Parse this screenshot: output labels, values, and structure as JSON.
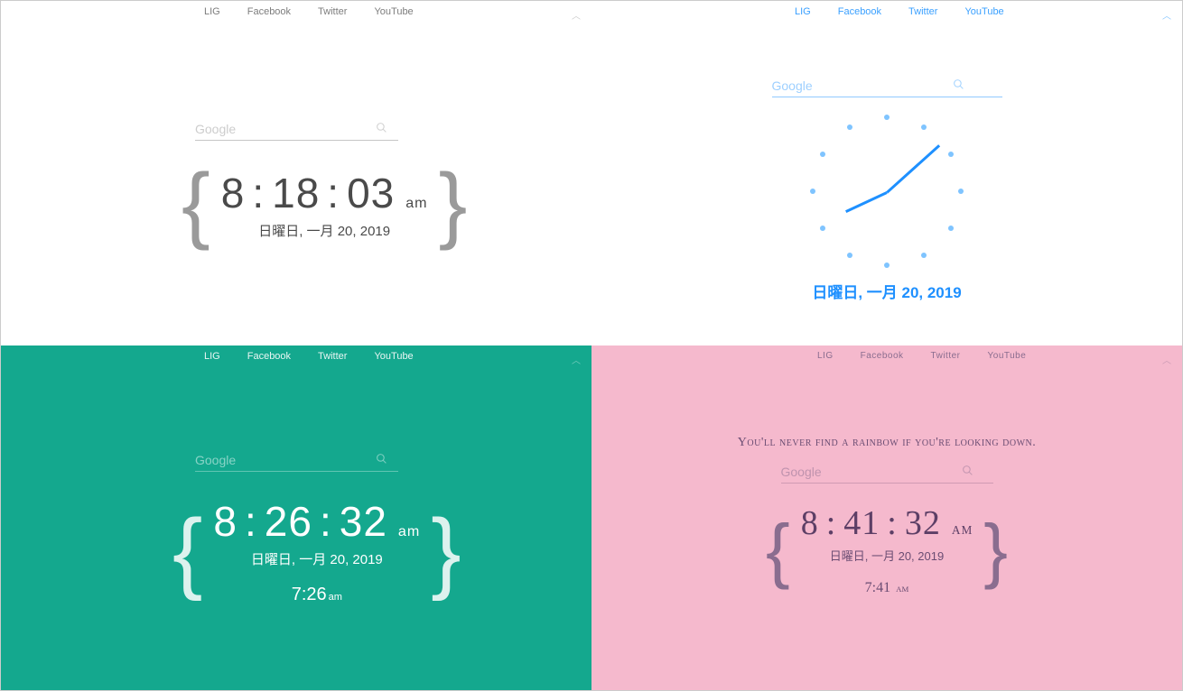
{
  "nav_links": [
    "LIG",
    "Facebook",
    "Twitter",
    "YouTube"
  ],
  "search_placeholder": "Google",
  "panels": {
    "p1": {
      "hour": "8",
      "min": "18",
      "sec": "03",
      "ampm": "am",
      "date": "日曜日, 一月 20, 2019"
    },
    "p2": {
      "date": "日曜日, 一月 20, 2019",
      "hour_angle": 245,
      "min_angle": 48
    },
    "p3": {
      "hour": "8",
      "min": "26",
      "sec": "32",
      "ampm": "am",
      "date": "日曜日, 一月 20, 2019",
      "sub_hour": "7",
      "sub_min": "26",
      "sub_ampm": "am"
    },
    "p4": {
      "quote": "You'll never find a rainbow if you're looking down.",
      "hour": "8",
      "min": "41",
      "sec": "32",
      "ampm": "AM",
      "date": "日曜日, 一月 20, 2019",
      "sub_hour": "7",
      "sub_min": "41",
      "sub_ampm": "AM"
    }
  },
  "colors": {
    "teal": "#14a88e",
    "pink": "#f5b9cd",
    "blue": "#1e90ff"
  }
}
